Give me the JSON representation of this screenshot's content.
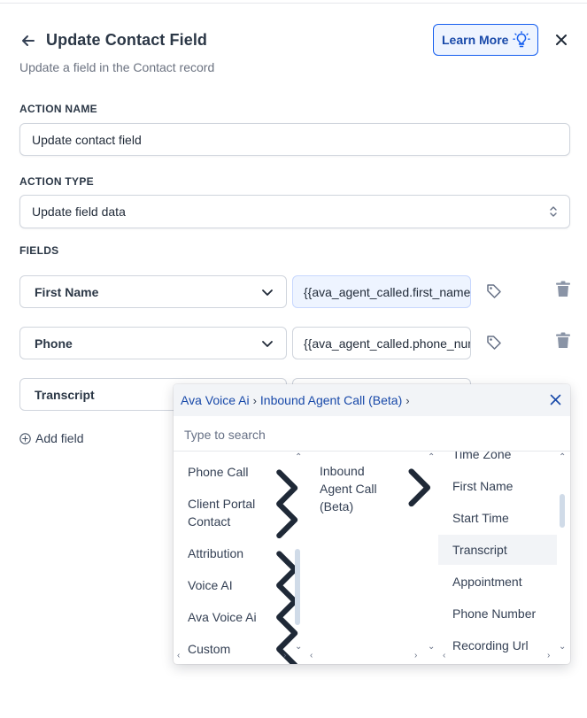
{
  "header": {
    "title": "Update Contact Field",
    "subtitle": "Update a field in the Contact record",
    "learn_more": "Learn More"
  },
  "action_name": {
    "label": "ACTION NAME",
    "value": "Update contact field"
  },
  "action_type": {
    "label": "ACTION TYPE",
    "value": "Update field data"
  },
  "fields": {
    "label": "FIELDS",
    "rows": [
      {
        "field": "First Name",
        "value": "{{ava_agent_called.first_name}}"
      },
      {
        "field": "Phone",
        "value": "{{ava_agent_called.phone_number}}"
      },
      {
        "field": "Transcript",
        "value": ""
      }
    ],
    "add_label": "Add field"
  },
  "picker": {
    "breadcrumb": [
      "Ava Voice Ai",
      "Inbound Agent Call (Beta)"
    ],
    "search_placeholder": "Type to search",
    "col1": [
      "Phone Call",
      "Client Portal Contact",
      "Attribution",
      "Voice AI",
      "Ava Voice Ai",
      "Custom"
    ],
    "col2": [
      "Inbound Agent Call (Beta)"
    ],
    "col3": [
      "Time Zone",
      "First Name",
      "Start Time",
      "Transcript",
      "Appointment",
      "Phone Number",
      "Recording Url"
    ],
    "selected": "Transcript"
  },
  "colors": {
    "accent": "#155eef",
    "accent_bg": "#eef4ff",
    "text": "#2b3746"
  }
}
